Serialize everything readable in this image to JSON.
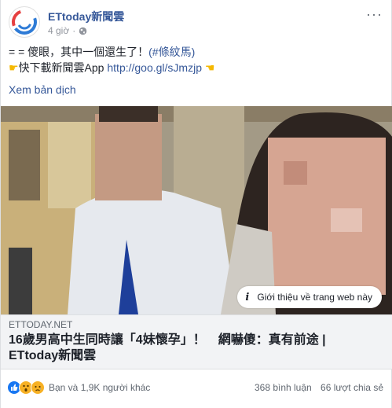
{
  "post": {
    "page_name": "ETtoday新聞雲",
    "time": "4 giờ",
    "dot": "·",
    "more": "···",
    "line1_text": "= = 傻眼，其中一個還生了！",
    "line1_hashtag": "(#條紋馬)",
    "line2_prefix": "快下載新聞雲App",
    "line2_link": "http://goo.gl/sJmzjp",
    "translate": "Xem bản dịch"
  },
  "image": {
    "info_label": "Giới thiệu về trang web này"
  },
  "preview": {
    "domain": "ETTODAY.NET",
    "headline": "16歲男高中生同時讓「4妹懷孕」！　網嚇傻：真有前途 | ETtoday新聞雲"
  },
  "footer": {
    "reactions_text": "Bạn và 1,9K người khác",
    "comments": "368 bình luận",
    "shares": "66 lượt chia sẻ"
  },
  "colors": {
    "link": "#365899",
    "like": "#1877f2",
    "wow": "#f7b125"
  },
  "icons": [
    "logo-icon",
    "globe-icon",
    "more-icon",
    "hand-pointing-right-icon",
    "hand-pointing-left-icon",
    "info-icon",
    "like-reaction-icon",
    "wow-reaction-icon",
    "sad-reaction-icon"
  ]
}
